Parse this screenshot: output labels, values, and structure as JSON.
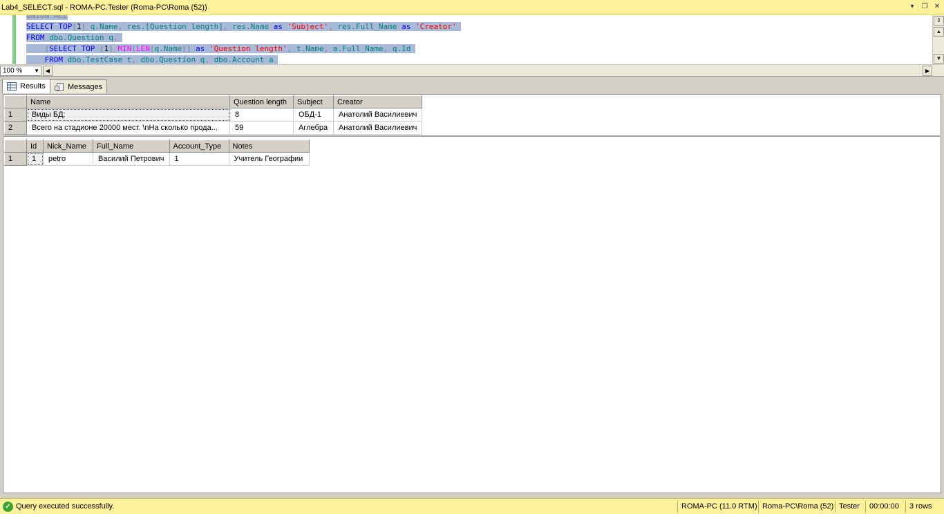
{
  "window": {
    "title": "Lab4_SELECT.sql - ROMA-PC.Tester (Roma-PC\\Roma (52))"
  },
  "editor": {
    "lines": [
      [
        {
          "t": "UNION ALL",
          "c": "gr",
          "s": true
        }
      ],
      [
        {
          "t": "SELECT",
          "c": "kw",
          "s": true
        },
        {
          "t": " ",
          "s": true
        },
        {
          "t": "TOP",
          "c": "kw",
          "s": true
        },
        {
          "t": "(",
          "c": "gr",
          "s": true
        },
        {
          "t": "1",
          "s": true
        },
        {
          "t": ") ",
          "c": "gr",
          "s": true
        },
        {
          "t": "q.Name",
          "c": "id",
          "s": true
        },
        {
          "t": ", ",
          "c": "gr",
          "s": true
        },
        {
          "t": "res.[Question length]",
          "c": "id",
          "s": true
        },
        {
          "t": ", ",
          "c": "gr",
          "s": true
        },
        {
          "t": "res.Name",
          "c": "id",
          "s": true
        },
        {
          "t": " ",
          "s": true
        },
        {
          "t": "as",
          "c": "kw",
          "s": true
        },
        {
          "t": " ",
          "s": true
        },
        {
          "t": "'Subject'",
          "c": "str",
          "s": true
        },
        {
          "t": ", ",
          "c": "gr",
          "s": true
        },
        {
          "t": "res.Full_Name",
          "c": "id",
          "s": true
        },
        {
          "t": " ",
          "s": true
        },
        {
          "t": "as",
          "c": "kw",
          "s": true
        },
        {
          "t": " ",
          "s": true
        },
        {
          "t": "'Creator'",
          "c": "str",
          "s": true
        },
        {
          "t": " ",
          "s": true
        }
      ],
      [
        {
          "t": "FROM",
          "c": "kw",
          "s": true
        },
        {
          "t": " ",
          "s": true
        },
        {
          "t": "dbo.Question q",
          "c": "id",
          "s": true
        },
        {
          "t": ",",
          "c": "gr",
          "s": true
        },
        {
          "t": " ",
          "s": true
        }
      ],
      [
        {
          "t": "    ",
          "s": true
        },
        {
          "t": "(",
          "c": "gr",
          "s": true
        },
        {
          "t": "SELECT",
          "c": "kw",
          "s": true
        },
        {
          "t": " ",
          "s": true
        },
        {
          "t": "TOP",
          "c": "kw",
          "s": true
        },
        {
          "t": " ",
          "s": true
        },
        {
          "t": "(",
          "c": "gr",
          "s": true
        },
        {
          "t": "1",
          "s": true
        },
        {
          "t": ") ",
          "c": "gr",
          "s": true
        },
        {
          "t": "MIN",
          "c": "fn",
          "s": true
        },
        {
          "t": "(",
          "c": "gr",
          "s": true
        },
        {
          "t": "LEN",
          "c": "fn",
          "s": true
        },
        {
          "t": "(",
          "c": "gr",
          "s": true
        },
        {
          "t": "q.Name",
          "c": "id",
          "s": true
        },
        {
          "t": ")) ",
          "c": "gr",
          "s": true
        },
        {
          "t": "as",
          "c": "kw",
          "s": true
        },
        {
          "t": " ",
          "s": true
        },
        {
          "t": "'Question length'",
          "c": "str",
          "s": true
        },
        {
          "t": ", ",
          "c": "gr",
          "s": true
        },
        {
          "t": "t.Name",
          "c": "id",
          "s": true
        },
        {
          "t": ", ",
          "c": "gr",
          "s": true
        },
        {
          "t": "a.Full_Name",
          "c": "id",
          "s": true
        },
        {
          "t": ", ",
          "c": "gr",
          "s": true
        },
        {
          "t": "q.Id",
          "c": "id",
          "s": true
        },
        {
          "t": " ",
          "s": true
        }
      ],
      [
        {
          "t": "    ",
          "s": true
        },
        {
          "t": "FROM",
          "c": "kw",
          "s": true
        },
        {
          "t": " ",
          "s": true
        },
        {
          "t": "dbo.TestCase t",
          "c": "id",
          "s": true
        },
        {
          "t": ", ",
          "c": "gr",
          "s": true
        },
        {
          "t": "dbo.Question q",
          "c": "id",
          "s": true
        },
        {
          "t": ", ",
          "c": "gr",
          "s": true
        },
        {
          "t": "dbo.Account a",
          "c": "id",
          "s": true
        },
        {
          "t": " ",
          "s": true
        }
      ]
    ]
  },
  "zoom": {
    "value": "100 %"
  },
  "tabs": [
    {
      "label": "Results",
      "active": true
    },
    {
      "label": "Messages",
      "active": false
    }
  ],
  "grid1": {
    "columns": [
      "Name",
      "Question length",
      "Subject",
      "Creator"
    ],
    "rows": [
      [
        "1",
        "Виды БД:",
        "8",
        "ОБД-1",
        "Анатолий Василиевич"
      ],
      [
        "2",
        "Всего на стадионе 20000 мест. \\nНа сколько прода...",
        "59",
        "Аглебра",
        "Анатолий Василиевич"
      ]
    ]
  },
  "grid2": {
    "columns": [
      "Id",
      "Nick_Name",
      "Full_Name",
      "Account_Type",
      "Notes"
    ],
    "rows": [
      [
        "1",
        "1",
        "petro",
        "Василий Петрович",
        "1",
        "Учитель Географии"
      ]
    ]
  },
  "status": {
    "message": "Query executed successfully.",
    "server": "ROMA-PC (11.0 RTM)",
    "user": "Roma-PC\\Roma (52)",
    "database": "Tester",
    "elapsed": "00:00:00",
    "rows": "3 rows"
  },
  "colors": {
    "titlebar": "#fff29d",
    "statusbar": "#fff29d",
    "keyword": "#0000ff",
    "string": "#ff0000",
    "function": "#ff00ff",
    "identifier": "#008080",
    "selection": "#a9b9d8"
  }
}
